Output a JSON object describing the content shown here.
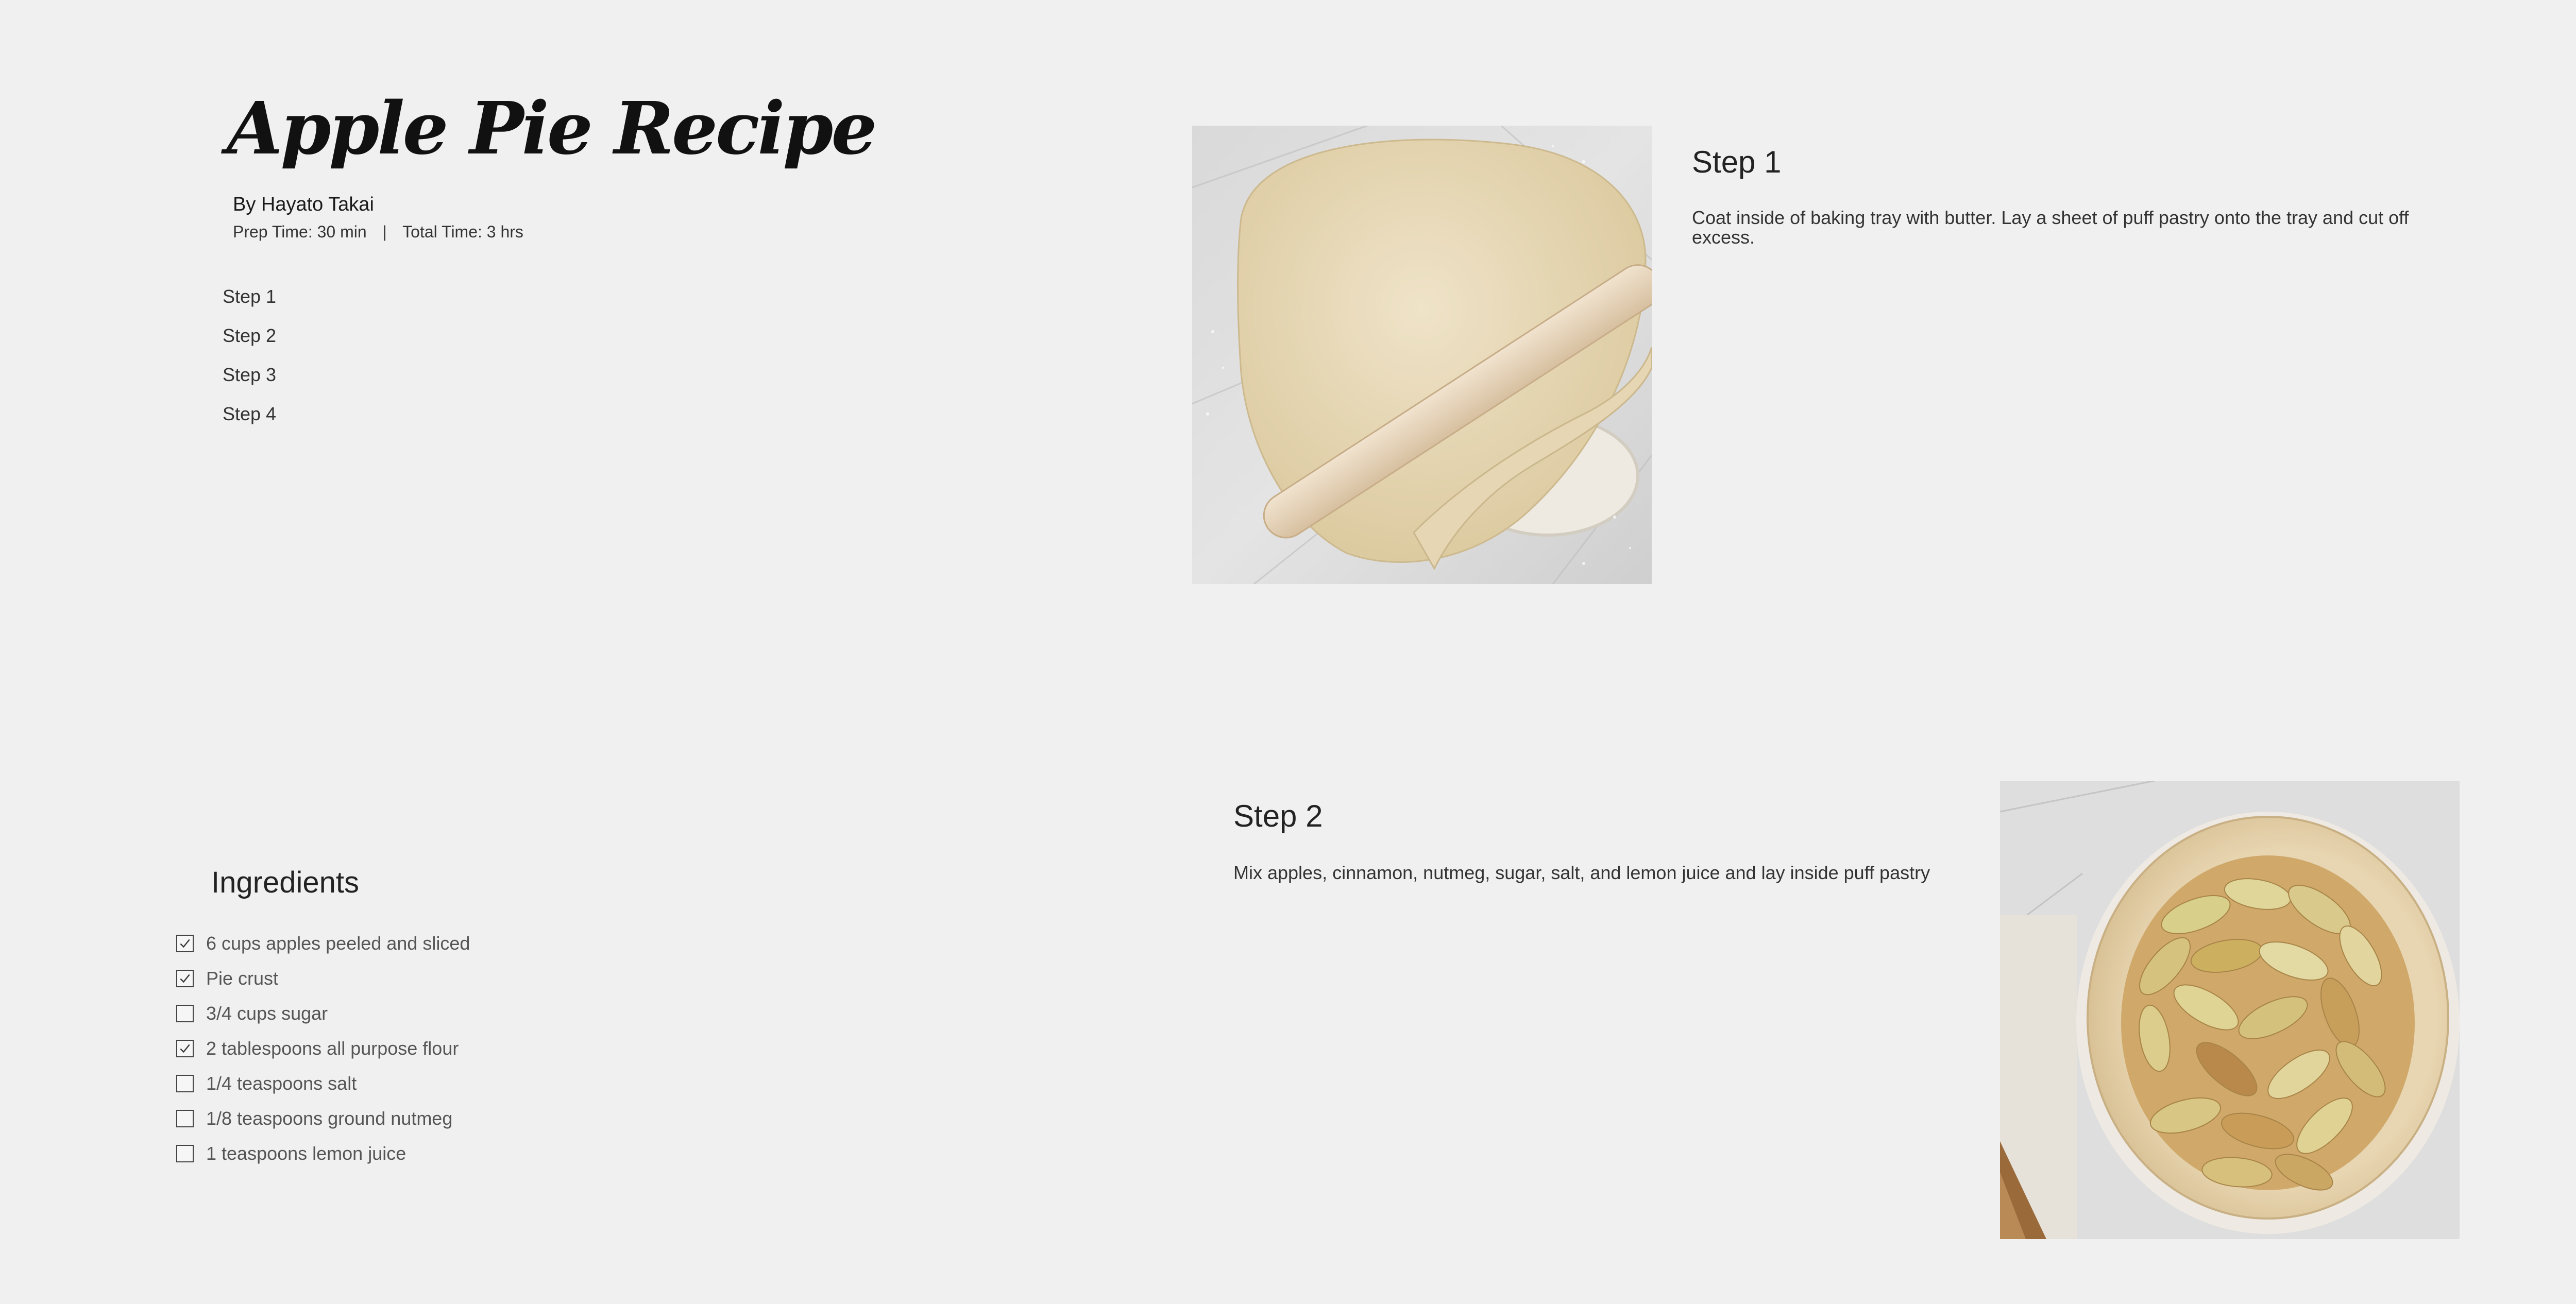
{
  "recipe": {
    "title": "Apple Pie Recipe",
    "author": "By Hayato Takai",
    "prep_time": "Prep Time: 30 min",
    "separator": "|",
    "total_time": "Total Time: 3 hrs"
  },
  "step_nav": {
    "items": [
      {
        "label": "Step 1"
      },
      {
        "label": "Step 2"
      },
      {
        "label": "Step 3"
      },
      {
        "label": "Step 4"
      }
    ]
  },
  "ingredients": {
    "title": "Ingredients",
    "items": [
      {
        "label": "6 cups apples peeled and sliced",
        "checked": true
      },
      {
        "label": "Pie crust",
        "checked": true
      },
      {
        "label": "3/4 cups sugar",
        "checked": false
      },
      {
        "label": "2 tablespoons all purpose flour",
        "checked": true
      },
      {
        "label": "1/4 teaspoons salt",
        "checked": false
      },
      {
        "label": "1/8 teaspoons ground nutmeg",
        "checked": false
      },
      {
        "label": "1 teaspoons lemon juice",
        "checked": false
      }
    ]
  },
  "steps": [
    {
      "heading": "Step 1",
      "text": "Coat inside of baking tray with butter. Lay a sheet of puff pastry onto the tray and cut off excess.",
      "image_icon": "rolled-pie-dough-photo"
    },
    {
      "heading": "Step 2",
      "text": "Mix apples, cinnamon, nutmeg, sugar, salt, and lemon juice and lay inside puff pastry",
      "image_icon": "apple-filled-pie-photo"
    }
  ],
  "colors": {
    "background": "#f0f0f0",
    "text": "#222222",
    "checkbox_border": "#444444"
  }
}
